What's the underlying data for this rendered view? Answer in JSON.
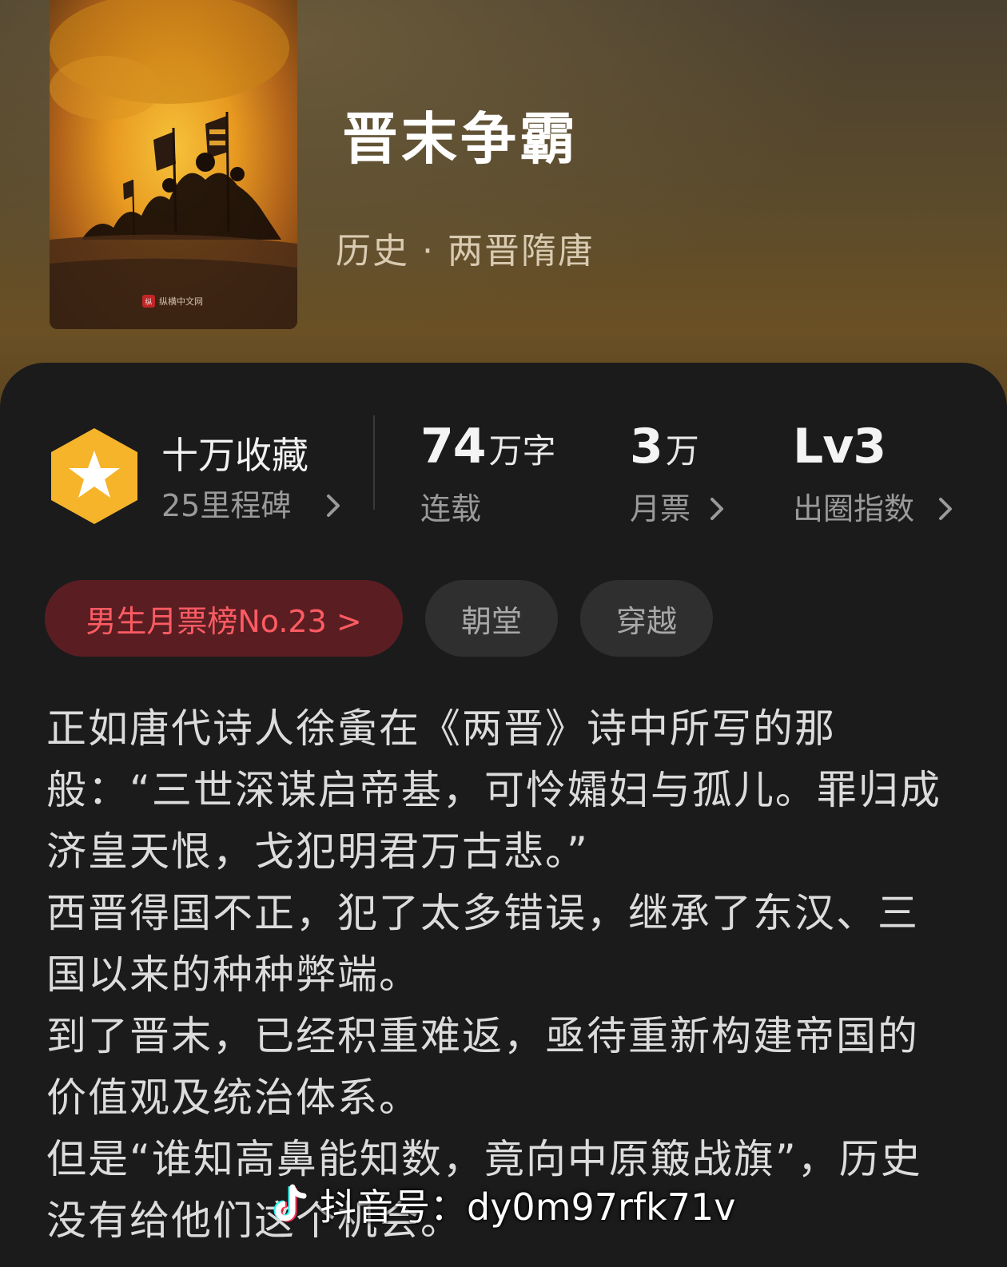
{
  "book": {
    "title": "晋末争霸",
    "genre": "历史 · 两晋隋唐",
    "cover_publisher": "纵横中文网"
  },
  "stats": {
    "favorites": {
      "label": "十万收藏",
      "milestone": "25里程碑",
      "icon": "star-badge-icon"
    },
    "words": {
      "number": "74",
      "unit": "万字",
      "label": "连载"
    },
    "monthly_tickets": {
      "number": "3",
      "unit": "万",
      "label": "月票"
    },
    "influence": {
      "value": "Lv3",
      "label": "出圈指数"
    }
  },
  "tags": {
    "rank": "男生月票榜No.23 >",
    "items": [
      "朝堂",
      "穿越"
    ]
  },
  "synopsis": [
    "正如唐代诗人徐夤在《两晋》诗中所写的那般：“三世深谋启帝基，可怜孀妇与孤儿。罪归成济皇天恨，戈犯明君万古悲。”",
    "西晋得国不正，犯了太多错误，继承了东汉、三国以来的种种弊端。",
    "到了晋末，已经积重难返，亟待重新构建帝国的价值观及统治体系。",
    "但是“谁知高鼻能知数，竟向中原簸战旗”，历史没有给他们这个机会。"
  ],
  "watermark": {
    "icon": "tiktok-logo-icon",
    "text": "抖音号：dy0m97rfk71v"
  },
  "colors": {
    "accent_rank_text": "#ff5b63",
    "rank_chip_bg": "#5a1e22",
    "badge_gold": "#f6b42a"
  }
}
